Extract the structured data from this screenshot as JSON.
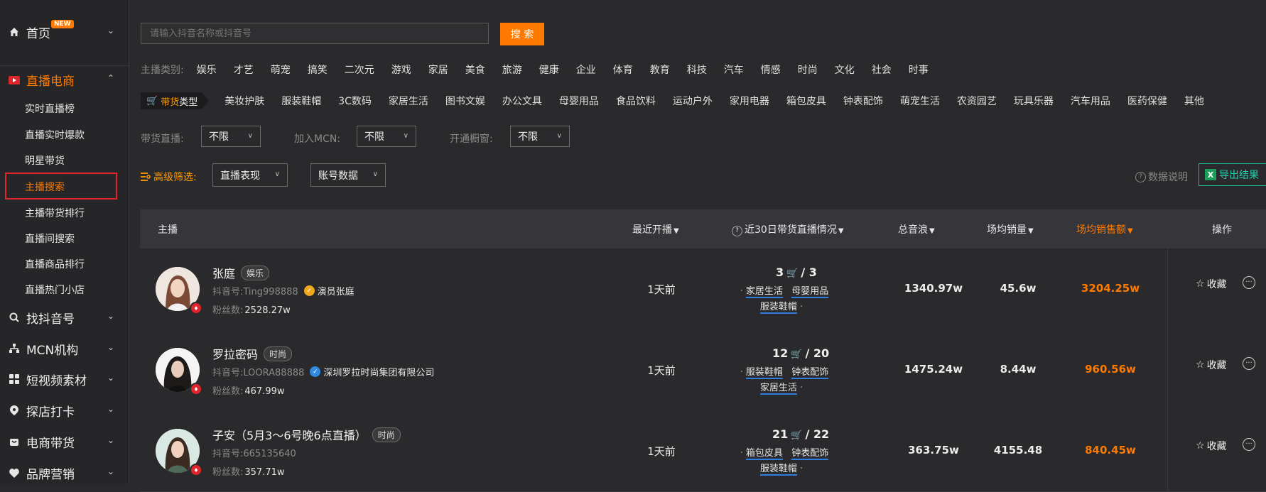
{
  "sidebar": {
    "home": {
      "label": "首页",
      "badge": "NEW"
    },
    "live_commerce": {
      "label": "直播电商"
    },
    "sub_items": [
      "实时直播榜",
      "直播实时爆款",
      "明星带货",
      "主播搜索",
      "主播带货排行",
      "直播间搜索",
      "直播商品排行",
      "直播热门小店"
    ],
    "sections": [
      "找抖音号",
      "MCN机构",
      "短视频素材",
      "探店打卡",
      "电商带货",
      "品牌营销"
    ]
  },
  "search": {
    "placeholder": "请输入抖音名称或抖音号",
    "button": "搜 索"
  },
  "anchor_category": {
    "label": "主播类别:",
    "items": [
      "娱乐",
      "才艺",
      "萌宠",
      "搞笑",
      "二次元",
      "游戏",
      "家居",
      "美食",
      "旅游",
      "健康",
      "企业",
      "体育",
      "教育",
      "科技",
      "汽车",
      "情感",
      "时尚",
      "文化",
      "社会",
      "时事"
    ]
  },
  "goods_type": {
    "tag_a": "带货",
    "tag_b": "类型",
    "items": [
      "美妆护肤",
      "服装鞋帽",
      "3C数码",
      "家居生活",
      "图书文娱",
      "办公文具",
      "母婴用品",
      "食品饮料",
      "运动户外",
      "家用电器",
      "箱包皮具",
      "钟表配饰",
      "萌宠生活",
      "农资园艺",
      "玩具乐器",
      "汽车用品",
      "医药保健",
      "其他"
    ]
  },
  "filters": {
    "live_label": "带货直播:",
    "live_value": "不限",
    "mcn_label": "加入MCN:",
    "mcn_value": "不限",
    "window_label": "开通橱窗:",
    "window_value": "不限"
  },
  "advanced": {
    "label": "高级筛选:",
    "performance": "直播表现",
    "account_data": "账号数据",
    "info": "数据说明",
    "export": "导出结果"
  },
  "table": {
    "headers": {
      "anchor": "主播",
      "recent": "最近开播",
      "live30": "近30日带货直播情况",
      "sound": "总音浪",
      "avg_sales": "场均销量",
      "avg_amount": "场均销售额",
      "ops": "操作"
    },
    "rows": [
      {
        "name": "张庭",
        "tag": "娱乐",
        "account": "抖音号:Ting998888",
        "verified": "演员张庭",
        "verify_color": "#f0a81c",
        "fans_label": "粉丝数:",
        "fans": "2528.27w",
        "recent": "1天前",
        "live_goods": "3",
        "live_total": "3",
        "cats": [
          "家居生活",
          "母婴用品",
          "服装鞋帽"
        ],
        "sound": "1340.97w",
        "avg_sales": "45.6w",
        "avg_amount": "3204.25w",
        "fav": "收藏"
      },
      {
        "name": "罗拉密码",
        "tag": "时尚",
        "account": "抖音号:LOORA88888",
        "verified": "深圳罗拉时尚集团有限公司",
        "verify_color": "#2f8ae0",
        "fans_label": "粉丝数:",
        "fans": "467.99w",
        "recent": "1天前",
        "live_goods": "12",
        "live_total": "20",
        "cats": [
          "服装鞋帽",
          "钟表配饰",
          "家居生活"
        ],
        "sound": "1475.24w",
        "avg_sales": "8.44w",
        "avg_amount": "960.56w",
        "fav": "收藏"
      },
      {
        "name": "子安（5月3～6号晚6点直播）",
        "tag": "时尚",
        "account": "抖音号:665135640",
        "verified": "",
        "verify_color": "",
        "fans_label": "粉丝数:",
        "fans": "357.71w",
        "recent": "1天前",
        "live_goods": "21",
        "live_total": "22",
        "cats": [
          "箱包皮具",
          "钟表配饰",
          "服装鞋帽"
        ],
        "sound": "363.75w",
        "avg_sales": "4155.48",
        "avg_amount": "840.45w",
        "fav": "收藏"
      }
    ]
  },
  "colors": {
    "accent": "#ff7a00",
    "highlight_box": "#e0262c",
    "export": "#22d1b0",
    "underline": "#2f7fe0"
  }
}
